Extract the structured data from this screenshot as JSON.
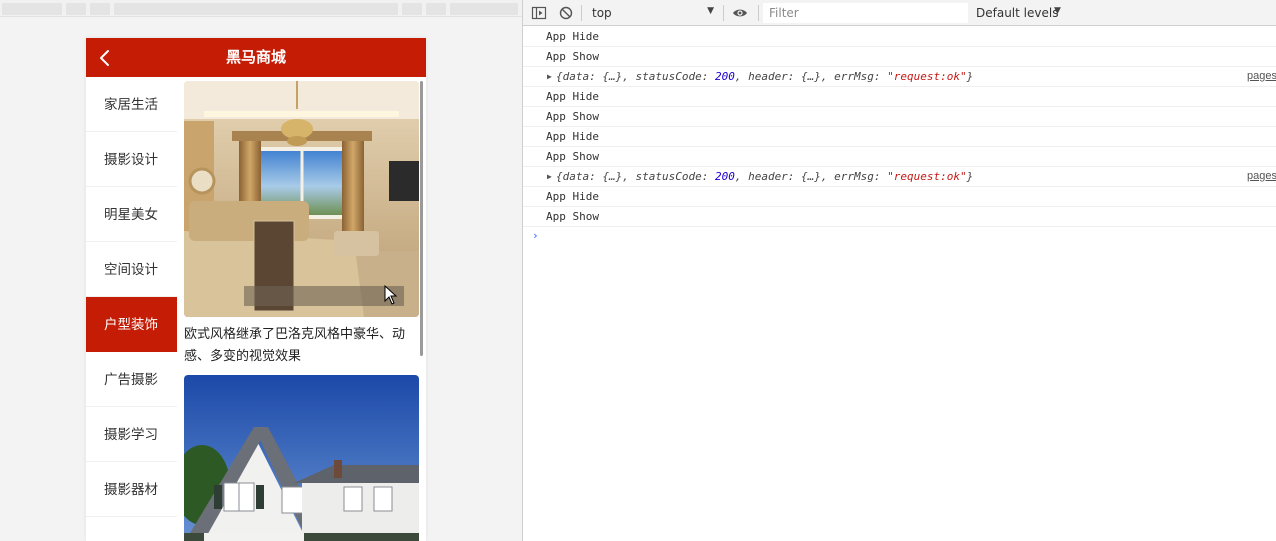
{
  "simulator": {
    "nav_title": "黑马商城",
    "categories": [
      {
        "label": "家居生活",
        "active": false
      },
      {
        "label": "摄影设计",
        "active": false
      },
      {
        "label": "明星美女",
        "active": false
      },
      {
        "label": "空间设计",
        "active": false
      },
      {
        "label": "户型装饰",
        "active": true
      },
      {
        "label": "广告摄影",
        "active": false
      },
      {
        "label": "摄影学习",
        "active": false
      },
      {
        "label": "摄影器材",
        "active": false
      }
    ],
    "content": {
      "caption": "欧式风格继承了巴洛克风格中豪华、动感、多变的视觉效果"
    },
    "colors": {
      "brand": "#c41c05",
      "active_bg": "#c41c05"
    }
  },
  "devtools": {
    "context": "top",
    "filter_placeholder": "Filter",
    "levels": "Default levels",
    "icons": [
      "sidebar-toggle-icon",
      "clear-console-icon",
      "eye-icon"
    ],
    "logs": [
      {
        "type": "text",
        "text": "App Hide"
      },
      {
        "type": "text",
        "text": "App Show"
      },
      {
        "type": "object",
        "pre": "{data: {…}, statusCode: ",
        "num": "200",
        "mid": ", header: {…}, errMsg: ",
        "str": "\"request:ok\"",
        "post": "}",
        "source": "pages"
      },
      {
        "type": "text",
        "text": "App Hide"
      },
      {
        "type": "text",
        "text": "App Show"
      },
      {
        "type": "text",
        "text": "App Hide"
      },
      {
        "type": "text",
        "text": "App Show"
      },
      {
        "type": "object",
        "pre": "{data: {…}, statusCode: ",
        "num": "200",
        "mid": ", header: {…}, errMsg: ",
        "str": "\"request:ok\"",
        "post": "}",
        "source": "pages"
      },
      {
        "type": "text",
        "text": "App Hide"
      },
      {
        "type": "text",
        "text": "App Show"
      }
    ],
    "prompt": "›"
  }
}
